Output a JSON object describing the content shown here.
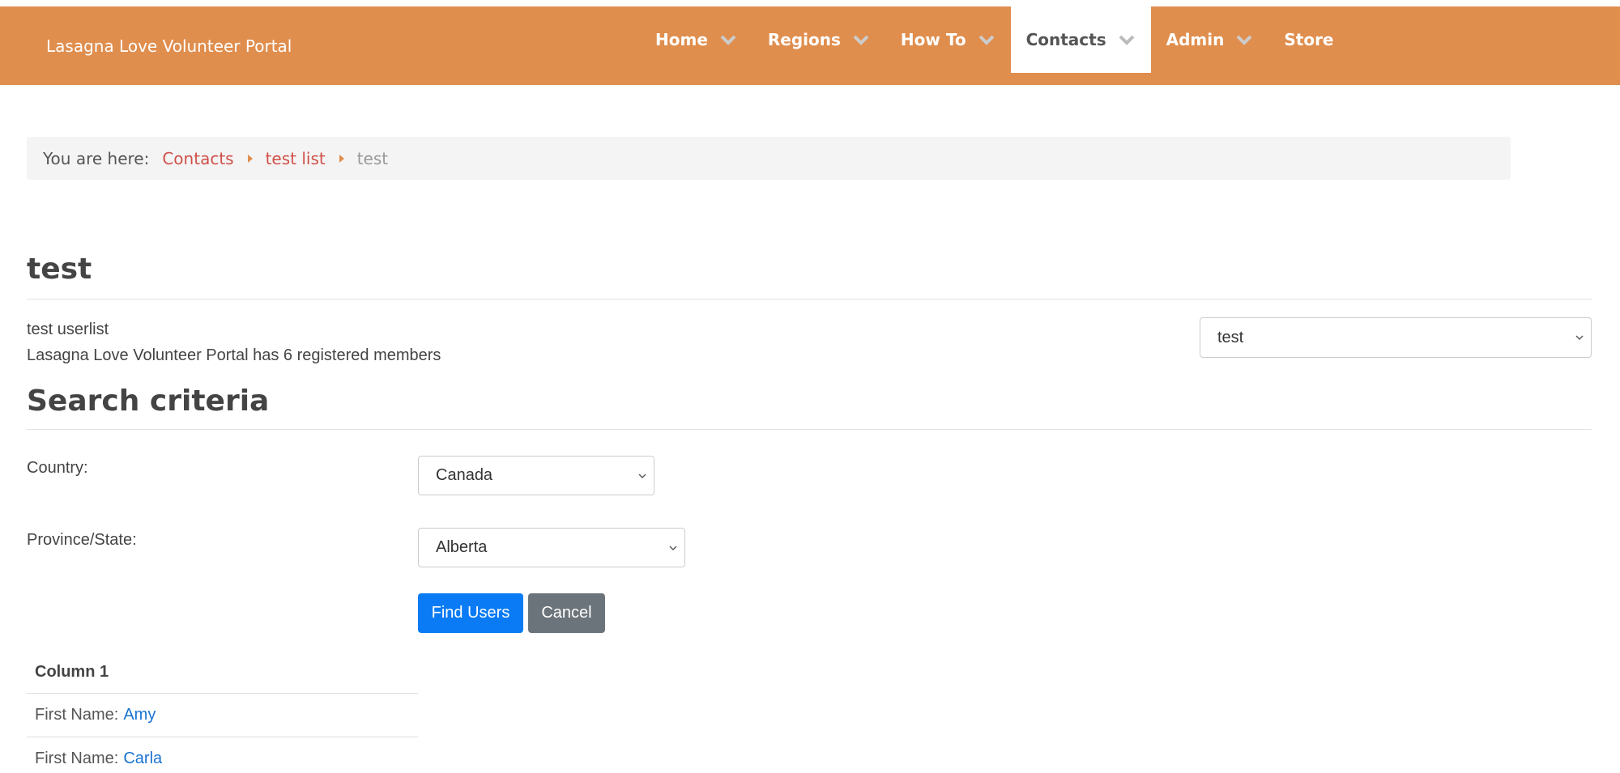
{
  "brand": "Lasagna Love Volunteer Portal",
  "nav": [
    {
      "label": "Home",
      "dropdown": true,
      "active": false
    },
    {
      "label": "Regions",
      "dropdown": true,
      "active": false
    },
    {
      "label": "How To",
      "dropdown": true,
      "active": false
    },
    {
      "label": "Contacts",
      "dropdown": true,
      "active": true
    },
    {
      "label": "Admin",
      "dropdown": true,
      "active": false
    },
    {
      "label": "Store",
      "dropdown": false,
      "active": false
    }
  ],
  "breadcrumb": {
    "prefix": "You are here:",
    "links": [
      "Contacts",
      "test list"
    ],
    "current": "test"
  },
  "page": {
    "title": "test",
    "description": "test userlist",
    "member_count_text": "Lasagna Love Volunteer Portal has 6 registered members",
    "list_select_value": "test"
  },
  "search": {
    "title": "Search criteria",
    "country_label": "Country:",
    "country_value": "Canada",
    "province_label": "Province/State:",
    "province_value": "Alberta",
    "find_label": "Find Users",
    "cancel_label": "Cancel"
  },
  "results": {
    "column_header": "Column 1",
    "rows": [
      {
        "label": "First Name:",
        "value": "Amy"
      },
      {
        "label": "First Name:",
        "value": "Carla"
      }
    ]
  },
  "colors": {
    "navbar": "#e08e4e",
    "breadcrumb_link": "#d0504a",
    "primary_button": "#0a7bf5",
    "secondary_button": "#6c747b",
    "result_link": "#1a73d2"
  }
}
